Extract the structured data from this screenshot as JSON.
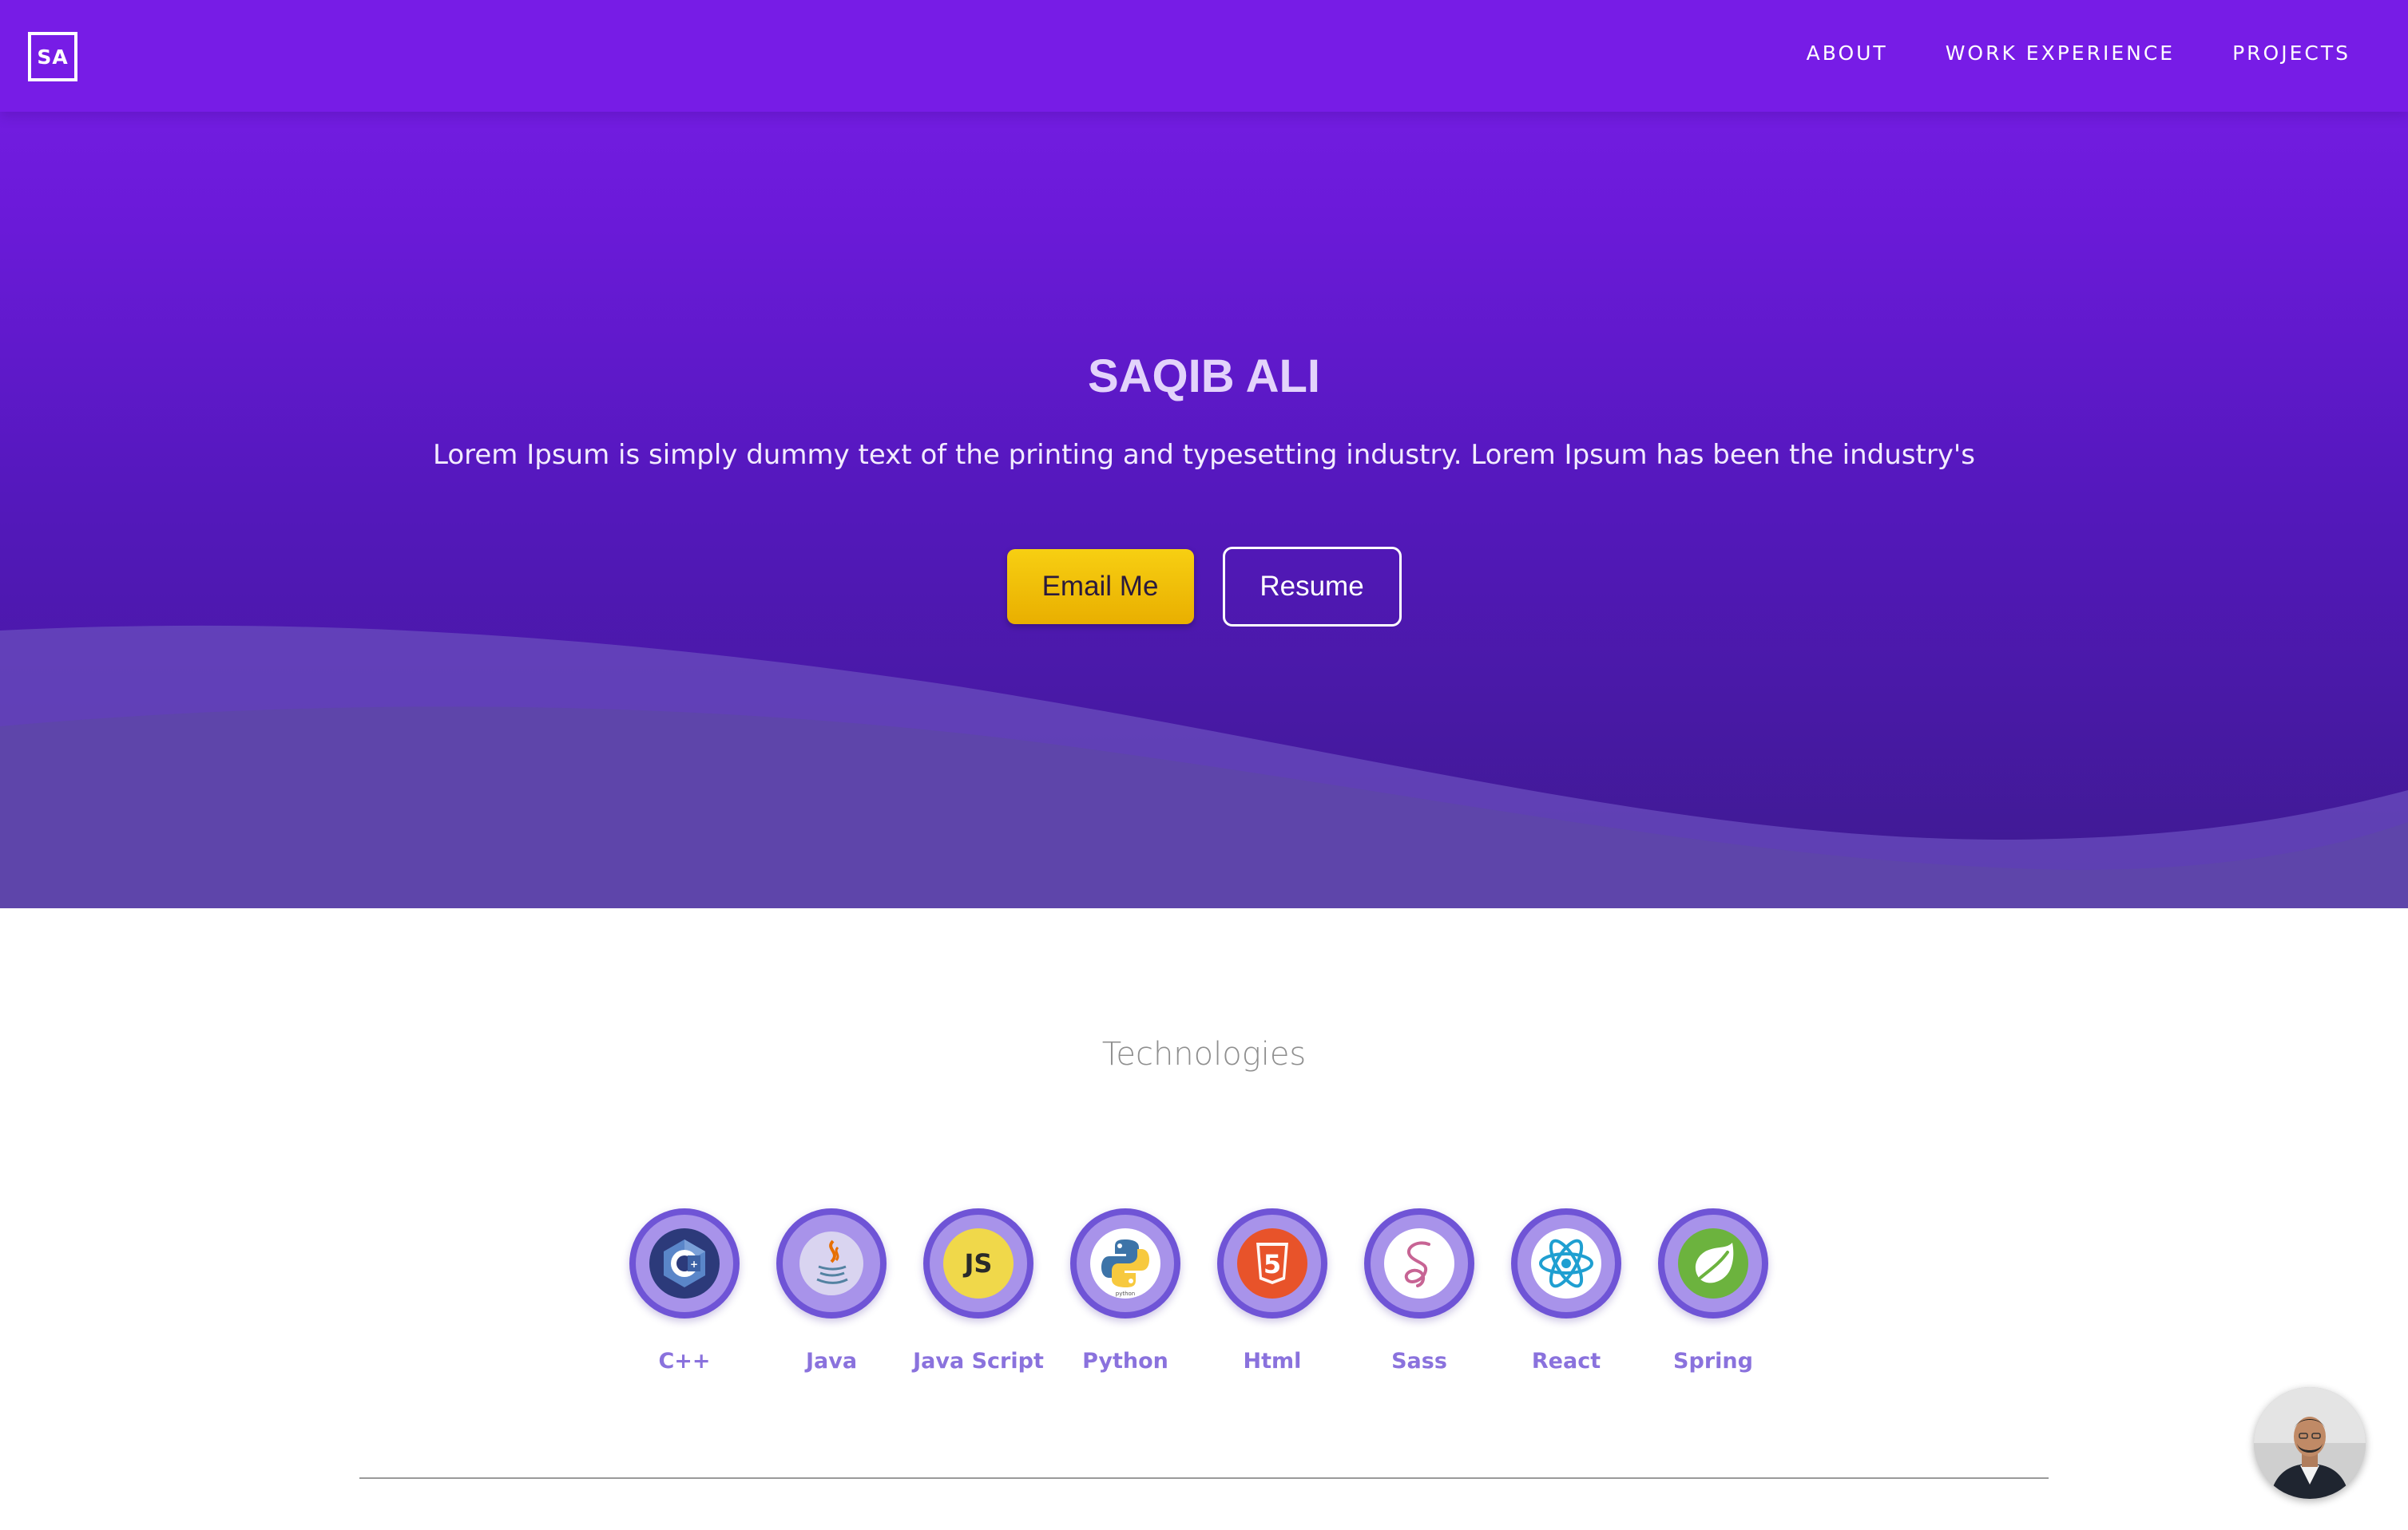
{
  "nav": {
    "logo_text": "SA",
    "links": [
      "ABOUT",
      "WORK EXPERIENCE",
      "PROJECTS"
    ]
  },
  "hero": {
    "name": "SAQIB ALI",
    "tagline": "Lorem Ipsum is simply dummy text of the printing and typesetting industry. Lorem Ipsum has been the industry's",
    "email_button": "Email Me",
    "resume_button": "Resume"
  },
  "technologies": {
    "heading": "Technologies",
    "items": [
      {
        "label": "C++",
        "icon": "cpp-icon"
      },
      {
        "label": "Java",
        "icon": "java-icon"
      },
      {
        "label": "Java Script",
        "icon": "javascript-icon",
        "icon_text": "JS"
      },
      {
        "label": "Python",
        "icon": "python-icon",
        "icon_text": "python"
      },
      {
        "label": "Html",
        "icon": "html5-icon",
        "icon_text": "5"
      },
      {
        "label": "Sass",
        "icon": "sass-icon"
      },
      {
        "label": "React",
        "icon": "react-icon"
      },
      {
        "label": "Spring",
        "icon": "spring-icon"
      }
    ]
  },
  "colors": {
    "nav_bg": "#771ce6",
    "accent_yellow": "#f2c40a",
    "tech_label": "#8a72dd",
    "tech_ring": "#6f54d6"
  }
}
